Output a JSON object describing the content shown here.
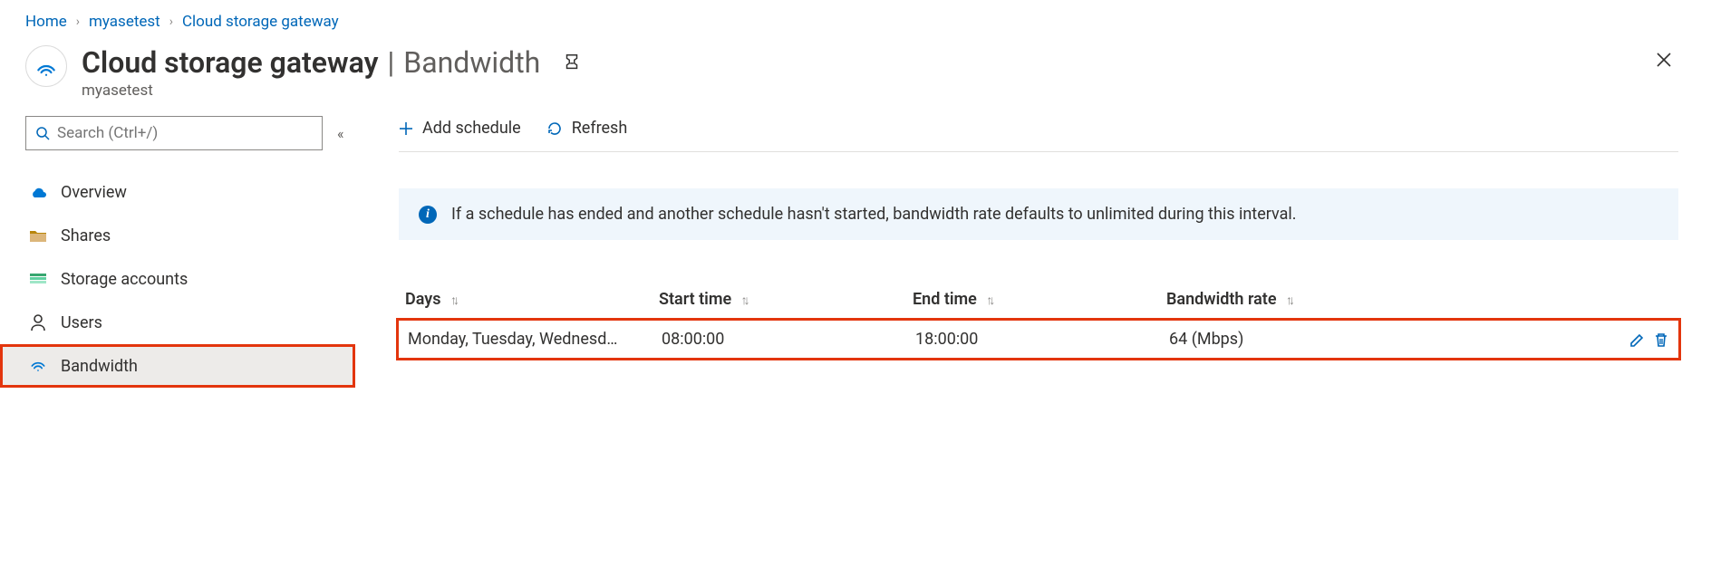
{
  "breadcrumb": [
    {
      "label": "Home"
    },
    {
      "label": "myasetest"
    },
    {
      "label": "Cloud storage gateway"
    }
  ],
  "header": {
    "title": "Cloud storage gateway",
    "section": "Bandwidth",
    "subtitle": "myasetest"
  },
  "sidebar": {
    "search_placeholder": "Search (Ctrl+/)",
    "items": [
      {
        "label": "Overview",
        "icon": "overview"
      },
      {
        "label": "Shares",
        "icon": "folder"
      },
      {
        "label": "Storage accounts",
        "icon": "storage"
      },
      {
        "label": "Users",
        "icon": "user"
      },
      {
        "label": "Bandwidth",
        "icon": "wifi",
        "selected": true,
        "highlighted": true
      }
    ]
  },
  "toolbar": {
    "add_label": "Add schedule",
    "refresh_label": "Refresh"
  },
  "info_banner": {
    "text": "If a schedule has ended and another schedule hasn't started, bandwidth rate defaults to unlimited during this interval."
  },
  "grid": {
    "columns": {
      "days": "Days",
      "start": "Start time",
      "end": "End time",
      "rate": "Bandwidth rate"
    },
    "rows": [
      {
        "days": "Monday, Tuesday, Wednesd…",
        "start": "08:00:00",
        "end": "18:00:00",
        "rate": "64 (Mbps)",
        "highlighted": true
      }
    ]
  }
}
